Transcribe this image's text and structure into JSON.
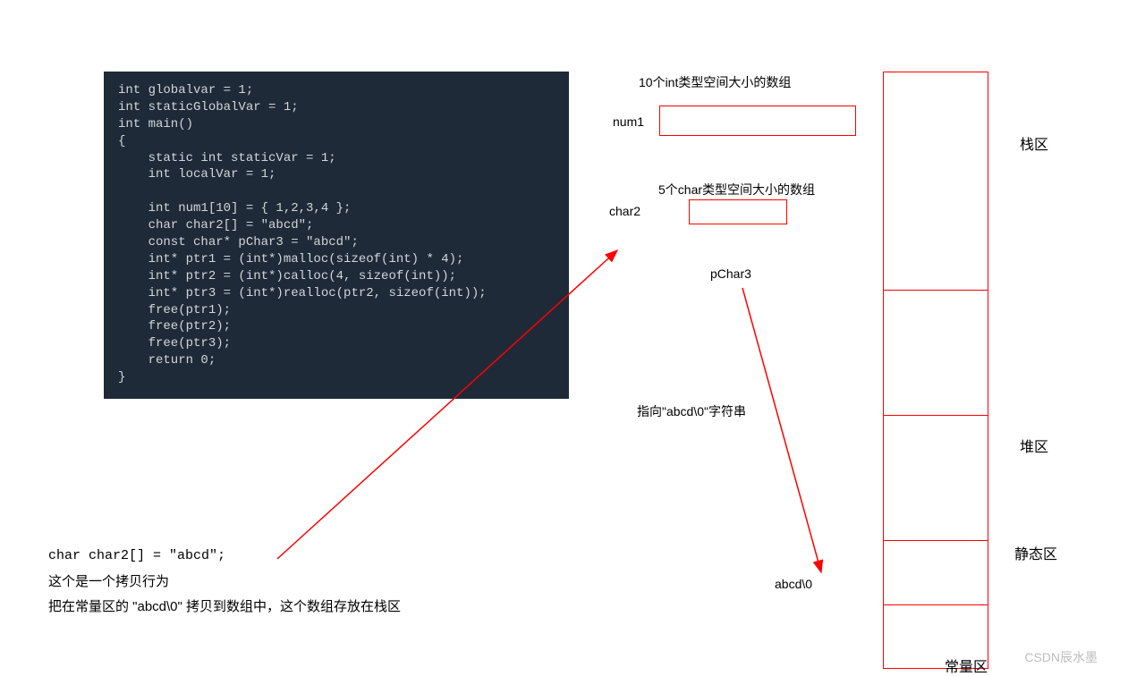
{
  "code": "int globalvar = 1;\nint staticGlobalVar = 1;\nint main()\n{\n    static int staticVar = 1;\n    int localVar = 1;\n\n    int num1[10] = { 1,2,3,4 };\n    char char2[] = \"abcd\";\n    const char* pChar3 = \"abcd\";\n    int* ptr1 = (int*)malloc(sizeof(int) * 4);\n    int* ptr2 = (int*)calloc(4, sizeof(int));\n    int* ptr3 = (int*)realloc(ptr2, sizeof(int));\n    free(ptr1);\n    free(ptr2);\n    free(ptr3);\n    return 0;\n}",
  "stack": {
    "int_array_label": "10个int类型空间大小的数组",
    "num1_label": "num1",
    "char_array_label": "5个char类型空间大小的数组",
    "char2_label": "char2",
    "pchar3_label": "pChar3",
    "pchar3_points_to": "指向\"abcd\\0\"字符串",
    "abcd_text": "abcd\\0"
  },
  "regions": {
    "stack": "栈区",
    "heap": "堆区",
    "static": "静态区",
    "const": "常量区"
  },
  "bottom_note": {
    "line1": "char char2[] = \"abcd\";",
    "line2": "这个是一个拷贝行为",
    "line3": "把在常量区的 \"abcd\\0\" 拷贝到数组中，这个数组存放在栈区"
  },
  "watermark": "CSDN辰水墨"
}
